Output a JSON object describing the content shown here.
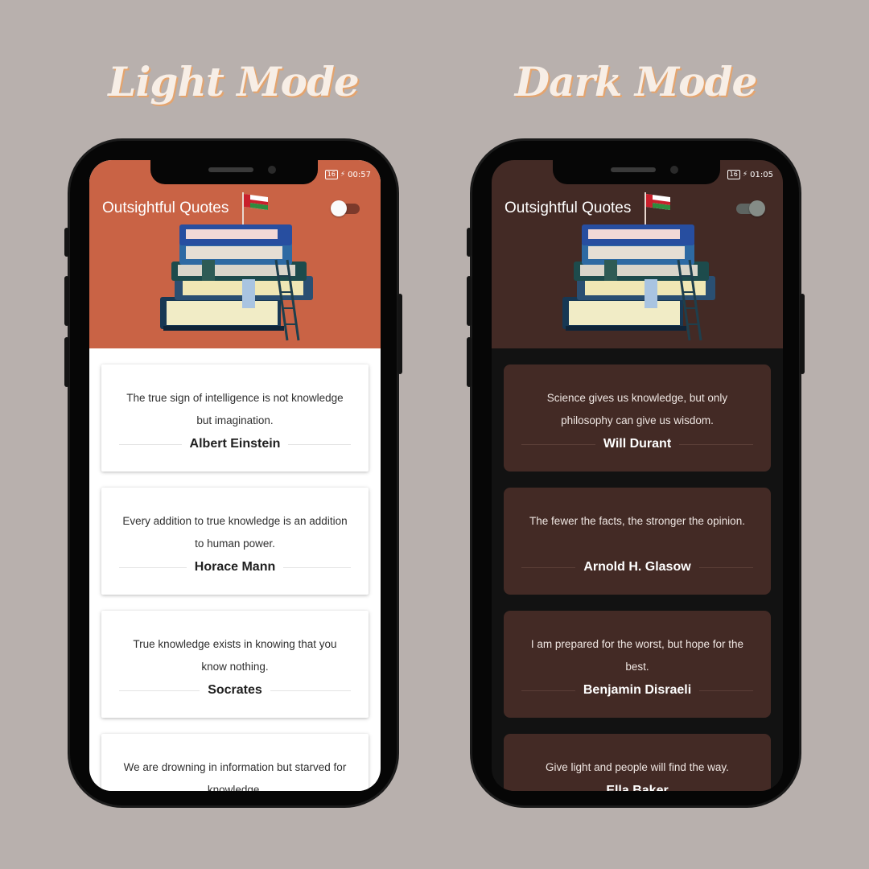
{
  "labels": {
    "light_mode": "Light Mode",
    "dark_mode": "Dark Mode"
  },
  "light_phone": {
    "app_title": "Outsightful Quotes",
    "time": "00:57",
    "battery": "16",
    "toggle_state": "off",
    "quotes": [
      {
        "text": "The true sign of intelligence is not knowledge but imagination.",
        "author": "Albert Einstein"
      },
      {
        "text": "Every addition to true knowledge is an addition to human power.",
        "author": "Horace Mann"
      },
      {
        "text": "True knowledge exists in knowing that you know nothing.",
        "author": "Socrates"
      },
      {
        "text": "We are drowning in information but starved for knowledge.",
        "author": ""
      }
    ]
  },
  "dark_phone": {
    "app_title": "Outsightful Quotes",
    "time": "01:05",
    "battery": "16",
    "toggle_state": "on",
    "quotes": [
      {
        "text": "Science gives us knowledge, but only philosophy can give us wisdom.",
        "author": "Will Durant"
      },
      {
        "text": "The fewer the facts, the stronger the opinion.",
        "author": "Arnold H. Glasow"
      },
      {
        "text": "I am prepared for the worst, but hope for the best.",
        "author": "Benjamin Disraeli"
      },
      {
        "text": "Give light and people will find the way.",
        "author": "Ella Baker"
      }
    ]
  },
  "colors": {
    "background": "#b8b0ad",
    "light_header": "#c96345",
    "dark_header": "#432a25",
    "dark_card": "#432a25",
    "dark_screen": "#121212"
  },
  "icons": [
    "flag-icon",
    "books-illustration",
    "theme-toggle",
    "battery-icon",
    "charging-icon"
  ]
}
